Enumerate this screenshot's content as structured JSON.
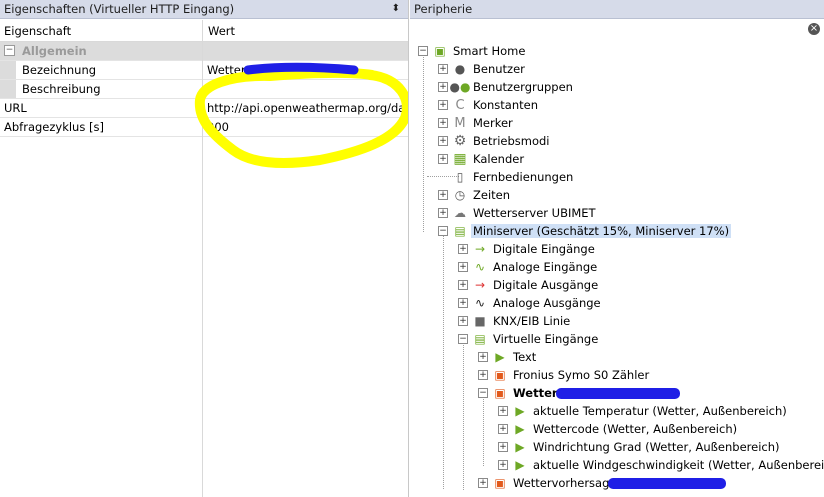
{
  "properties_panel": {
    "title": "Eigenschaften (Virtueller HTTP Eingang)",
    "pin_icon": "pin-icon",
    "col_property": "Eigenschaft",
    "col_value": "Wert",
    "category": "Allgemein",
    "rows": [
      {
        "key": "Bezeichnung",
        "value": "Wetter"
      },
      {
        "key": "Beschreibung",
        "value": ""
      },
      {
        "key": "URL",
        "value": "http://api.openweathermap.org/da..."
      },
      {
        "key": "Abfragezyklus [s]",
        "value": "900"
      }
    ]
  },
  "tree_panel": {
    "title": "Peripherie",
    "nodes": [
      {
        "label": "Smart Home",
        "icon": "home-icon"
      },
      {
        "label": "Benutzer",
        "icon": "user-icon"
      },
      {
        "label": "Benutzergruppen",
        "icon": "users-icon"
      },
      {
        "label": "Konstanten",
        "icon": "constant-icon"
      },
      {
        "label": "Merker",
        "icon": "flag-icon"
      },
      {
        "label": "Betriebsmodi",
        "icon": "gear-icon"
      },
      {
        "label": "Kalender",
        "icon": "calendar-icon"
      },
      {
        "label": "Fernbedienungen",
        "icon": "remote-icon"
      },
      {
        "label": "Zeiten",
        "icon": "clock-icon"
      },
      {
        "label": "Wetterserver UBIMET",
        "icon": "weather-icon"
      },
      {
        "label": "Miniserver (Geschätzt 15%, Miniserver 17%)",
        "icon": "miniserver-icon"
      },
      {
        "label": "Digitale Eingänge",
        "icon": "digital-input-icon"
      },
      {
        "label": "Analoge Eingänge",
        "icon": "analog-input-icon"
      },
      {
        "label": "Digitale Ausgänge",
        "icon": "digital-output-icon"
      },
      {
        "label": "Analoge Ausgänge",
        "icon": "analog-output-icon"
      },
      {
        "label": "KNX/EIB Linie",
        "icon": "knx-icon"
      },
      {
        "label": "Virtuelle Eingänge",
        "icon": "virtual-input-icon"
      },
      {
        "label": "Text",
        "icon": "text-input-icon"
      },
      {
        "label": "Fronius Symo S0 Zähler",
        "icon": "virtual-http-icon"
      },
      {
        "label": "Wetter",
        "icon": "virtual-http-icon"
      },
      {
        "label": "aktuelle Temperatur (Wetter, Außenbereich)",
        "icon": "input-command-icon"
      },
      {
        "label": "Wettercode (Wetter, Außenbereich)",
        "icon": "input-command-icon"
      },
      {
        "label": "Windrichtung Grad (Wetter, Außenbereich)",
        "icon": "input-command-icon"
      },
      {
        "label": "aktuelle Windgeschwindigkeit (Wetter, Außenbereich)",
        "icon": "input-command-icon"
      },
      {
        "label": "Wettervorhersage",
        "icon": "virtual-http-icon"
      }
    ]
  },
  "colors": {
    "selection": "#cfe0f6",
    "titlebar": "#d6dbe9",
    "annotation_yellow": "#ffff00",
    "redaction_blue": "#1f1fe6"
  }
}
